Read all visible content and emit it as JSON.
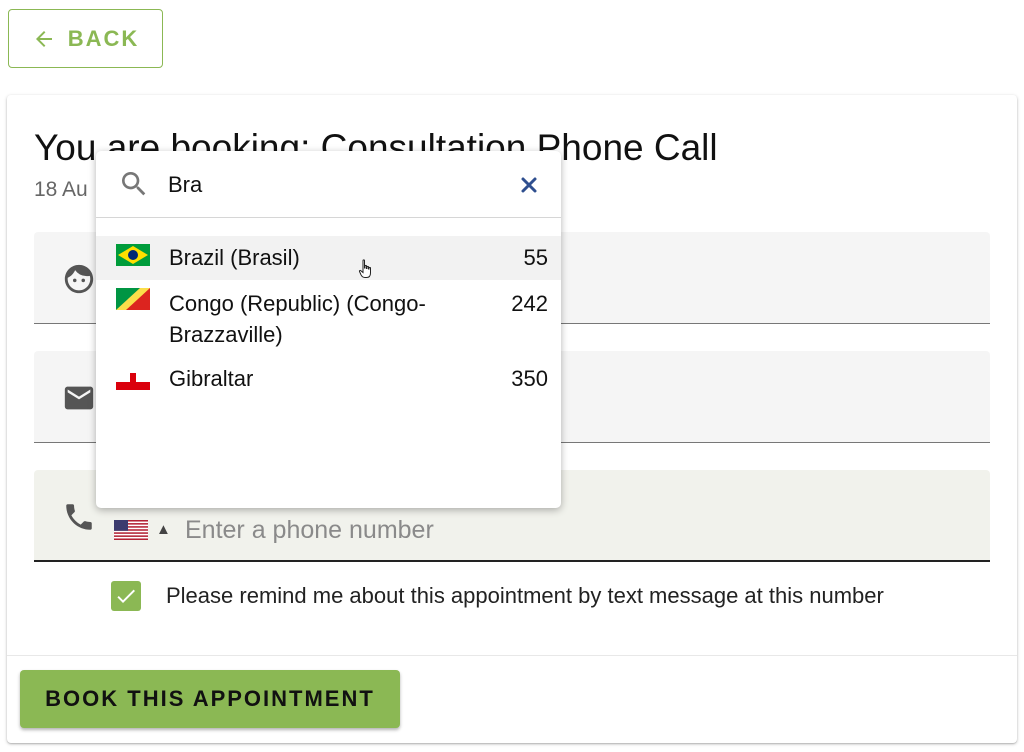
{
  "back_button": {
    "label": "BACK",
    "icon": "arrow-left-icon"
  },
  "booking": {
    "title": "You are booking: Consultation Phone Call",
    "subtitle": "18 Au"
  },
  "fields": {
    "name": {
      "icon": "face-icon"
    },
    "email": {
      "icon": "email-icon"
    },
    "phone": {
      "icon": "phone-icon",
      "flag": "us-flag-icon",
      "placeholder": "Enter a phone number",
      "value": ""
    }
  },
  "reminder": {
    "checked": true,
    "label": "Please remind me about this appointment by text message at this number"
  },
  "submit": {
    "label": "BOOK THIS APPOINTMENT"
  },
  "country_dropdown": {
    "search_value": "Bra",
    "countries": [
      {
        "name": "Brazil (Brasil)",
        "code": "55",
        "flag": "brazil-flag-icon",
        "hovered": true
      },
      {
        "name": "Congo (Republic) (Congo-Brazzaville)",
        "code": "242",
        "flag": "congo-flag-icon",
        "hovered": false
      },
      {
        "name": "Gibraltar",
        "code": "350",
        "flag": "gibraltar-flag-icon",
        "hovered": false
      }
    ]
  },
  "colors": {
    "accent": "#8bb854",
    "field_bg": "#f5f5f5",
    "phone_field_bg": "#f1f2ec",
    "clear_icon": "#2f4f8f"
  }
}
